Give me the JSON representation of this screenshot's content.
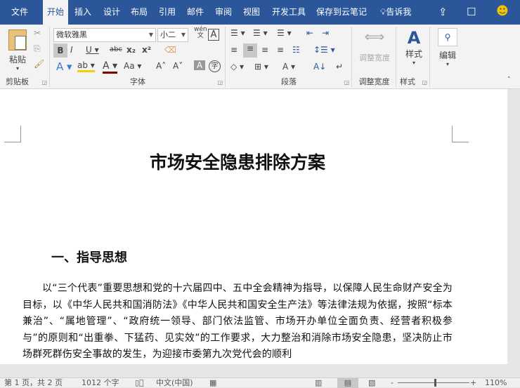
{
  "tabs": [
    {
      "label": "文件"
    },
    {
      "label": "开始",
      "active": true
    },
    {
      "label": "插入"
    },
    {
      "label": "设计"
    },
    {
      "label": "布局"
    },
    {
      "label": "引用"
    },
    {
      "label": "邮件"
    },
    {
      "label": "审阅"
    },
    {
      "label": "视图"
    },
    {
      "label": "开发工具"
    },
    {
      "label": "保存到云笔记"
    }
  ],
  "tell_me": "告诉我",
  "ribbon": {
    "clipboard": {
      "label": "剪贴板",
      "paste": "粘贴"
    },
    "font": {
      "label": "字体",
      "font_name": "微软雅黑",
      "font_size": "小二",
      "phonetic": "wén"
    },
    "paragraph": {
      "label": "段落"
    },
    "adjust_width": {
      "label": "调整宽度",
      "button": "调整宽度"
    },
    "styles": {
      "label": "样式",
      "button": "样式"
    },
    "editing": {
      "button": "编辑"
    }
  },
  "document": {
    "title": "市场安全隐患排除方案",
    "heading1": "一、指导思想",
    "paragraph": "以“三个代表”重要思想和党的十六届四中、五中全会精神为指导，以保障人民生命财产安全为目标，以《中华人民共和国消防法》《中华人民共和国安全生产法》等法律法规为依据，按照“标本兼治”、“属地管理”、“政府统一领导、部门依法监管、市场开办单位全面负责、经营者积极参与”的原则和“出重拳、下猛药、见实效”的工作要求，大力整治和消除市场安全隐患，坚决防止市场群死群伤安全事故的发生，为迎接市委第九次党代会的顺利"
  },
  "status": {
    "page": "第 1 页，共 2 页",
    "words": "1012 个字",
    "language": "中文(中国)",
    "zoom": "110%",
    "zoom_value": 110
  },
  "colors": {
    "accent": "#2b579a"
  }
}
